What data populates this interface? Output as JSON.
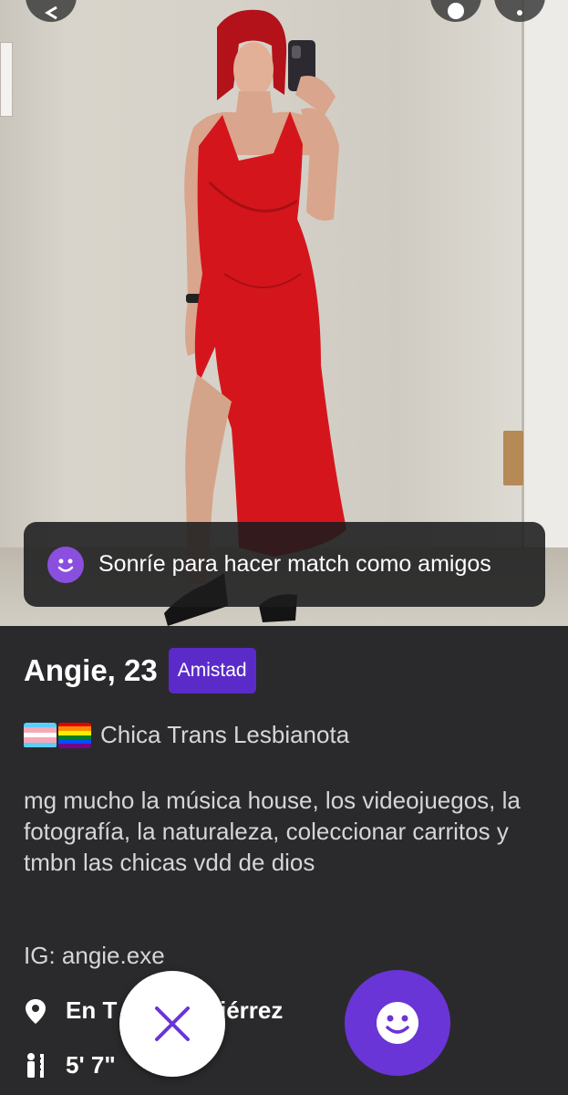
{
  "photo": {
    "alt": "Persona con vestido rojo tomando selfie en espejo"
  },
  "banner": {
    "text": "Sonríe para hacer match como amigos",
    "icon": "smile-icon",
    "icon_color": "#8b4fe0"
  },
  "profile": {
    "name_age": "Angie, 23",
    "mode_badge": "Amistad",
    "badge_color": "#5b2bc9",
    "identity_flags": [
      "transgender-flag",
      "rainbow-pride-flag"
    ],
    "identity": "Chica Trans Lesbianota",
    "bio": "mg mucho la música house, los videojuegos, la fotografía, la naturaleza, coleccionar carritos y tmbn las chicas vdd de dios",
    "instagram": "IG: angie.exe",
    "location_visible": "En T",
    "location_visible_end": "tiérrez",
    "height": "5' 7\""
  },
  "actions": {
    "pass_icon": "close-icon",
    "pass_color": "#6a35d6",
    "like_icon": "smile-icon",
    "like_color": "#6a35d6"
  }
}
